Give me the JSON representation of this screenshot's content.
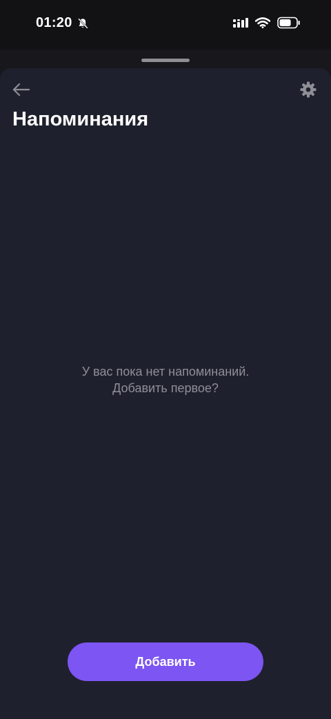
{
  "status_bar": {
    "time": "01:20",
    "icons": [
      "bell-off-icon",
      "signal-icon",
      "wifi-icon",
      "battery-icon"
    ],
    "battery_level": 0.7
  },
  "header": {
    "back_icon": "arrow-left-icon",
    "settings_icon": "gear-icon",
    "title": "Напоминания"
  },
  "empty_state": {
    "line1": "У вас пока нет напоминаний.",
    "line2": "Добавить первое?"
  },
  "actions": {
    "add_label": "Добавить"
  },
  "colors": {
    "sheet_background": "#1f202d",
    "accent": "#7c55f2",
    "muted_text": "#8e8e96"
  }
}
